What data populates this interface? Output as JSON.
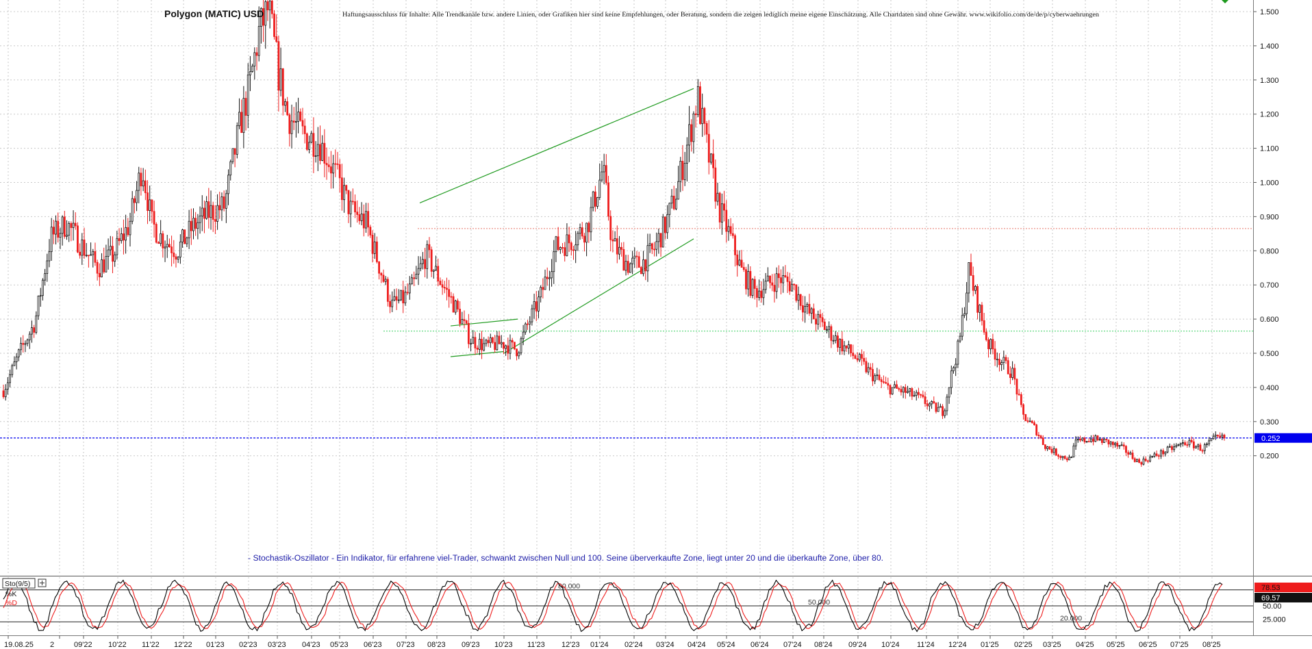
{
  "chart_data": {
    "type": "candlestick",
    "title": "Polygon (MATIC) USD",
    "disclaimer": "Haftungsausschluss für Inhalte: Alle Trendkanäle bzw. andere Linien, oder Grafiken hier sind keine Empfehlungen, oder Beratung, sondern die zeigen lediglich meine eigene Einschätzung. Alle Chartdaten sind ohne Gewähr. www.wikifolio.com/de/de/p/cyberwaehrungen",
    "annotation": "- Stochastik-Oszillator - Ein Indikator, für erfahrene viel-Trader, schwankt zwischen Null und 100. Seine überverkaufte Zone, liegt unter 20 und die überkaufte Zone, über 80.",
    "ylim": [
      0.15,
      1.535
    ],
    "y_ticks": [
      "1.500",
      "1.400",
      "1.300",
      "1.200",
      "1.100",
      "1.000",
      "0.900",
      "0.800",
      "0.700",
      "0.600",
      "0.500",
      "0.400",
      "0.300",
      "0.200"
    ],
    "x_labels": [
      "19.08.25",
      "2",
      "09'22",
      "10'22",
      "11'22",
      "12'22",
      "01'23",
      "02'23",
      "03'23",
      "04'23",
      "05'23",
      "06'23",
      "07'23",
      "08'23",
      "09'23",
      "10'23",
      "11'23",
      "12'23",
      "01'24",
      "02'24",
      "03'24",
      "04'24",
      "05'24",
      "06'24",
      "07'24",
      "08'24",
      "09'24",
      "10'24",
      "11'24",
      "12'24",
      "01'25",
      "02'25",
      "03'25",
      "04'25",
      "05'25",
      "06'25",
      "07'25",
      "08'25"
    ],
    "last_price": "0.252",
    "last_price_value": 0.252,
    "horizontal_lines": [
      {
        "name": "resistance",
        "value": 0.865,
        "color": "#e8786a"
      },
      {
        "name": "support",
        "value": 0.565,
        "color": "#38d060"
      },
      {
        "name": "current-price",
        "value": 0.252,
        "color": "#0000ee"
      }
    ],
    "trend_lines": [
      {
        "name": "channel-upper",
        "color": "#1e9a1e",
        "points": [
          [
            "07'23+",
            0.94
          ],
          [
            "04'24-",
            1.275
          ]
        ]
      },
      {
        "name": "channel-lower",
        "color": "#1e9a1e",
        "points": [
          [
            "10'23",
            0.5
          ],
          [
            "04'24-",
            0.835
          ]
        ]
      },
      {
        "name": "triangle-top",
        "color": "#1e9a1e",
        "points": [
          [
            "08'23+",
            0.58
          ],
          [
            "10'23+",
            0.6
          ]
        ]
      },
      {
        "name": "triangle-bottom",
        "color": "#1e9a1e",
        "points": [
          [
            "08'23+",
            0.49
          ],
          [
            "10'23",
            0.505
          ]
        ]
      }
    ],
    "price_path": [
      [
        0,
        0.39
      ],
      [
        0.5,
        0.5
      ],
      [
        1,
        0.59
      ],
      [
        1.5,
        0.84
      ],
      [
        2,
        0.88
      ],
      [
        2.6,
        0.8
      ],
      [
        3,
        0.75
      ],
      [
        3.5,
        0.79
      ],
      [
        4,
        0.88
      ],
      [
        4.4,
        1.05
      ],
      [
        4.7,
        0.88
      ],
      [
        5,
        0.84
      ],
      [
        5.5,
        0.8
      ],
      [
        6,
        0.87
      ],
      [
        6.5,
        0.91
      ],
      [
        7,
        0.93
      ],
      [
        7.5,
        1.17
      ],
      [
        7.8,
        1.28
      ],
      [
        8.1,
        1.44
      ],
      [
        8.4,
        1.51
      ],
      [
        8.7,
        1.33
      ],
      [
        9,
        1.2
      ],
      [
        9.5,
        1.14
      ],
      [
        10,
        1.12
      ],
      [
        10.5,
        1.03
      ],
      [
        11,
        0.92
      ],
      [
        11.5,
        0.88
      ],
      [
        12,
        0.73
      ],
      [
        12.3,
        0.64
      ],
      [
        12.7,
        0.66
      ],
      [
        13,
        0.7
      ],
      [
        13.4,
        0.79
      ],
      [
        13.8,
        0.72
      ],
      [
        14.3,
        0.64
      ],
      [
        14.8,
        0.54
      ],
      [
        15.3,
        0.52
      ],
      [
        15.8,
        0.53
      ],
      [
        16.3,
        0.51
      ],
      [
        16.6,
        0.58
      ],
      [
        17,
        0.66
      ],
      [
        17.5,
        0.81
      ],
      [
        18,
        0.83
      ],
      [
        18.5,
        0.87
      ],
      [
        19,
        1.04
      ],
      [
        19.3,
        0.82
      ],
      [
        19.8,
        0.76
      ],
      [
        20.2,
        0.76
      ],
      [
        20.6,
        0.8
      ],
      [
        21,
        0.88
      ],
      [
        21.3,
        0.96
      ],
      [
        21.7,
        1.12
      ],
      [
        22,
        1.25
      ],
      [
        22.3,
        1.1
      ],
      [
        22.7,
        0.92
      ],
      [
        23,
        0.85
      ],
      [
        23.4,
        0.74
      ],
      [
        23.8,
        0.68
      ],
      [
        24.2,
        0.7
      ],
      [
        24.6,
        0.72
      ],
      [
        25,
        0.7
      ],
      [
        25.5,
        0.62
      ],
      [
        26,
        0.58
      ],
      [
        26.5,
        0.53
      ],
      [
        27,
        0.49
      ],
      [
        27.5,
        0.44
      ],
      [
        28,
        0.4
      ],
      [
        28.5,
        0.39
      ],
      [
        29,
        0.37
      ],
      [
        29.5,
        0.34
      ],
      [
        29.8,
        0.33
      ],
      [
        30,
        0.42
      ],
      [
        30.3,
        0.53
      ],
      [
        30.6,
        0.74
      ],
      [
        30.9,
        0.64
      ],
      [
        31.2,
        0.53
      ],
      [
        31.6,
        0.48
      ],
      [
        32,
        0.44
      ],
      [
        32.3,
        0.32
      ],
      [
        32.7,
        0.28
      ],
      [
        33,
        0.23
      ],
      [
        33.5,
        0.2
      ],
      [
        33.8,
        0.19
      ],
      [
        34,
        0.24
      ],
      [
        34.5,
        0.25
      ],
      [
        35,
        0.24
      ],
      [
        35.5,
        0.22
      ],
      [
        36,
        0.18
      ],
      [
        36.5,
        0.2
      ],
      [
        37,
        0.22
      ],
      [
        37.5,
        0.24
      ],
      [
        38,
        0.22
      ],
      [
        38.4,
        0.25
      ],
      [
        38.7,
        0.252
      ]
    ],
    "stochastic": {
      "label": "Sto(9/5)",
      "k_label": "%K",
      "d_label": "%D",
      "k_value": "78.53",
      "d_value": "69.57",
      "k_color": "#000000",
      "d_color": "#ee1c1c",
      "levels": [
        "80.000",
        "50.000",
        "20.000"
      ],
      "y_ticks": [
        "25.000",
        "50.00"
      ],
      "ylim": [
        0,
        100
      ]
    }
  }
}
